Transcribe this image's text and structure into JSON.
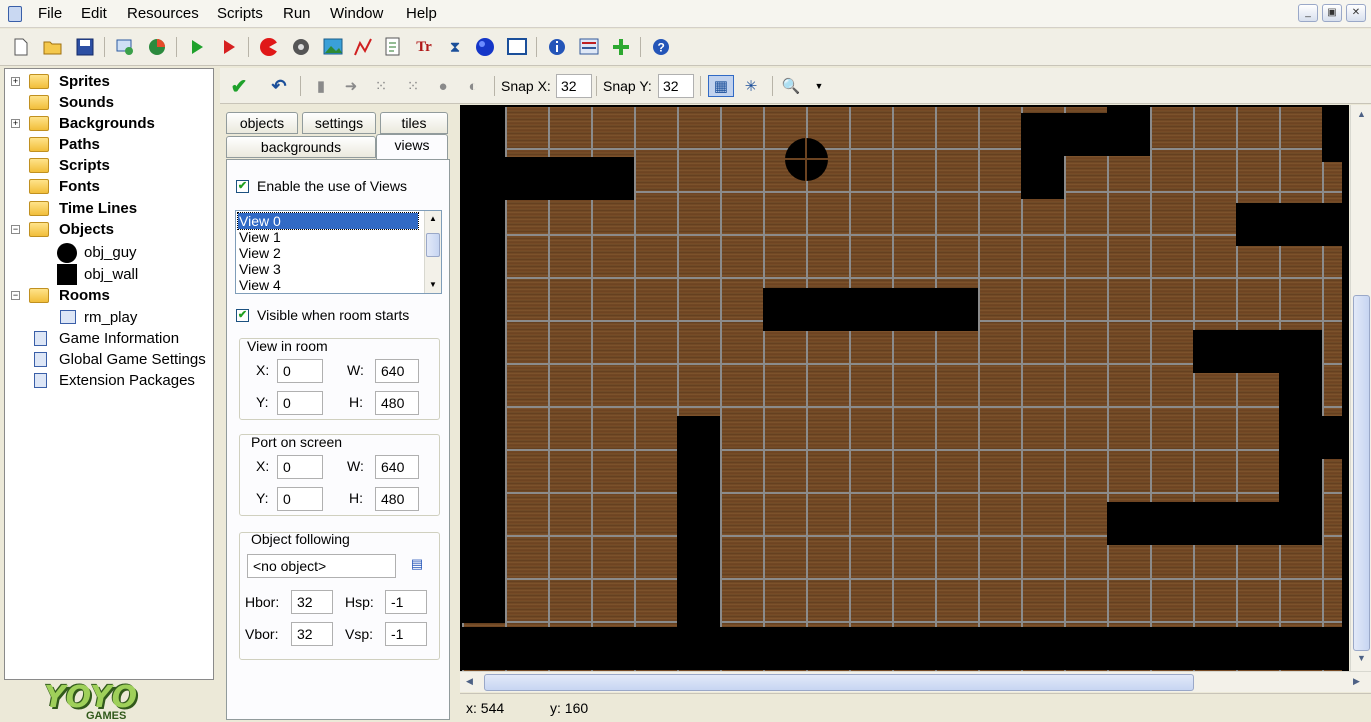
{
  "menu": [
    "File",
    "Edit",
    "Resources",
    "Scripts",
    "Run",
    "Window",
    "Help"
  ],
  "window_controls": {
    "minimize": "_",
    "restore": "▣",
    "close": "✕"
  },
  "toolbar_icons": [
    "new-file-icon",
    "open-folder-icon",
    "save-icon",
    "create-executable-icon",
    "publish-icon",
    "run-icon",
    "run-debug-icon",
    "add-sprite-icon",
    "add-sound-icon",
    "add-background-icon",
    "add-path-icon",
    "add-script-icon",
    "add-font-icon",
    "add-timeline-icon",
    "add-object-icon",
    "add-room-icon",
    "game-information-icon",
    "global-settings-icon",
    "extension-packages-icon",
    "help-icon"
  ],
  "tree": {
    "sprites": "Sprites",
    "sounds": "Sounds",
    "backgrounds": "Backgrounds",
    "paths": "Paths",
    "scripts": "Scripts",
    "fonts": "Fonts",
    "timelines": "Time Lines",
    "objects": "Objects",
    "object_items": [
      "obj_guy",
      "obj_wall"
    ],
    "rooms": "Rooms",
    "room_items": [
      "rm_play"
    ],
    "game_information": "Game Information",
    "global_game_settings": "Global Game Settings",
    "extension_packages": "Extension Packages"
  },
  "logo": {
    "text": "YOYO",
    "sub": "GAMES"
  },
  "room_toolbar": {
    "snap_x_label": "Snap X:",
    "snap_x": "32",
    "snap_y_label": "Snap Y:",
    "snap_y": "32"
  },
  "tabs": {
    "objects": "objects",
    "settings": "settings",
    "tiles": "tiles",
    "backgrounds": "backgrounds",
    "views": "views"
  },
  "views": {
    "enable_views": "Enable the use of Views",
    "list": [
      "View 0",
      "View 1",
      "View 2",
      "View 3",
      "View 4"
    ],
    "visible_when_starts": "Visible when room starts",
    "view_in_room": {
      "title": "View in room",
      "x_label": "X:",
      "x": "0",
      "w_label": "W:",
      "w": "640",
      "y_label": "Y:",
      "y": "0",
      "h_label": "H:",
      "h": "480"
    },
    "port_on_screen": {
      "title": "Port on screen",
      "x_label": "X:",
      "x": "0",
      "w_label": "W:",
      "w": "640",
      "y_label": "Y:",
      "y": "0",
      "h_label": "H:",
      "h": "480"
    },
    "object_following": {
      "title": "Object following",
      "value": "<no object>",
      "hbor_label": "Hbor:",
      "hbor": "32",
      "hsp_label": "Hsp:",
      "hsp": "-1",
      "vbor_label": "Vbor:",
      "vbor": "32",
      "vsp_label": "Vsp:",
      "vsp": "-1"
    }
  },
  "status": {
    "x": "x: 544",
    "y": "y: 160"
  },
  "colors": {
    "wall": "#000000",
    "floor": "#6b4321",
    "grid": "#8b8b8b"
  }
}
